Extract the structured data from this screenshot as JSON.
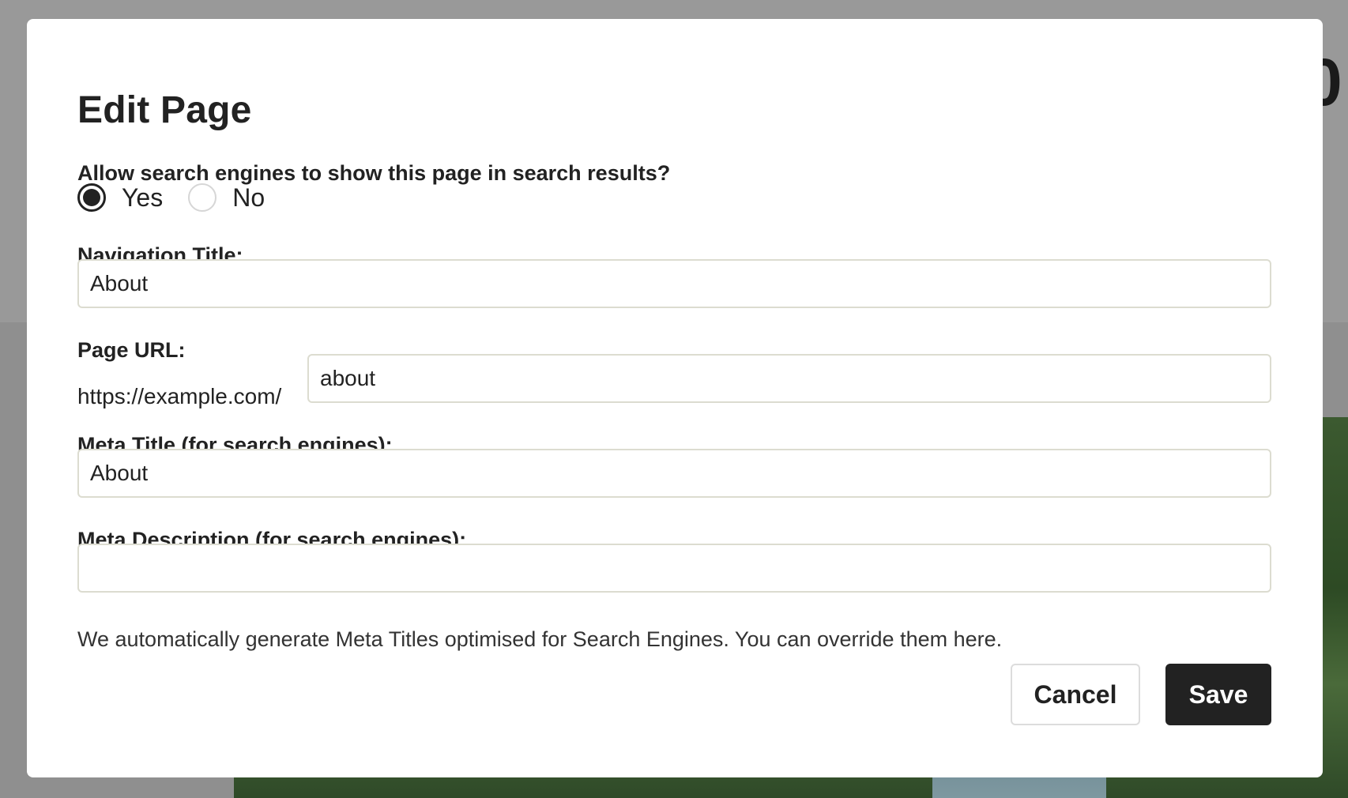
{
  "modal": {
    "title": "Edit Page"
  },
  "search_visibility": {
    "question": "Allow search engines to show this page in search results?",
    "options": [
      {
        "label": "Yes",
        "checked": true
      },
      {
        "label": "No",
        "checked": false
      }
    ]
  },
  "navigation_title": {
    "label": "Navigation Title:",
    "value": "About"
  },
  "page_url": {
    "label": "Page URL:",
    "prefix": "https://example.com/",
    "value": "about"
  },
  "meta_title": {
    "label": "Meta Title (for search engines):",
    "value": "About"
  },
  "meta_description": {
    "label": "Meta Description (for search engines):",
    "value": ""
  },
  "help_text": "We automatically generate Meta Titles optimised for Search Engines. You can override them here.",
  "actions": {
    "cancel_label": "Cancel",
    "save_label": "Save"
  },
  "colors": {
    "primary": "#222222",
    "overlay": "#999999",
    "input_border": "#dcdcd0"
  }
}
